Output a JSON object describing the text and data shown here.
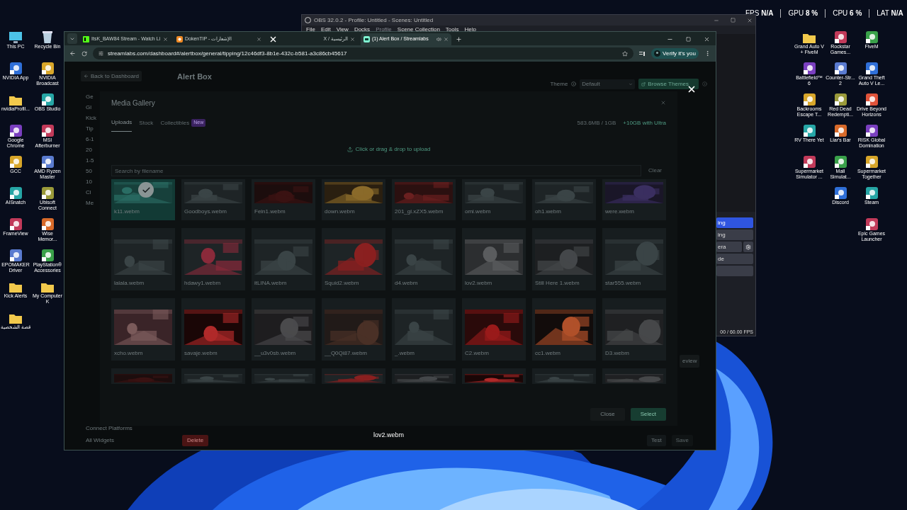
{
  "overlay_stats": [
    {
      "label": "FPS",
      "value": "N/A"
    },
    {
      "label": "GPU",
      "value": "8 %"
    },
    {
      "label": "CPU",
      "value": "6 %"
    },
    {
      "label": "LAT",
      "value": "N/A"
    }
  ],
  "desktop_left": [
    [
      {
        "label": "This PC",
        "kind": "pc"
      },
      {
        "label": "NVIDIA App",
        "kind": "app"
      },
      {
        "label": "nvidiaProfil...",
        "kind": "folder"
      },
      {
        "label": "Google Chrome",
        "kind": "app"
      },
      {
        "label": "GCC",
        "kind": "app"
      },
      {
        "label": "AISnatch",
        "kind": "app"
      },
      {
        "label": "FrameView",
        "kind": "app"
      },
      {
        "label": "EPOMAKER Driver",
        "kind": "app"
      },
      {
        "label": "Kick Alerts",
        "kind": "folder"
      },
      {
        "label": "قصة الشخصية",
        "kind": "folder"
      }
    ],
    [
      {
        "label": "Recycle Bin",
        "kind": "bin"
      },
      {
        "label": "NVIDIA Broadcast",
        "kind": "app"
      },
      {
        "label": "OBS Studio",
        "kind": "app"
      },
      {
        "label": "MSI Afterburner",
        "kind": "app"
      },
      {
        "label": "AMD Ryzen Master",
        "kind": "app"
      },
      {
        "label": "Ubisoft Connect",
        "kind": "app"
      },
      {
        "label": "Wise Memor...",
        "kind": "app"
      },
      {
        "label": "PlayStation® Accessories",
        "kind": "app"
      },
      {
        "label": "My Computer K",
        "kind": "folder"
      }
    ]
  ],
  "desktop_right": [
    [
      {
        "label": "Grand Auto V + FiveM",
        "kind": "folder"
      },
      {
        "label": "Battlefield™ 6",
        "kind": "app"
      },
      {
        "label": "Backrooms Escape T...",
        "kind": "app"
      },
      {
        "label": "RV There Yet",
        "kind": "app"
      },
      {
        "label": "Supermarket Simulator ...",
        "kind": "app"
      }
    ],
    [
      {
        "label": "Rockstar Games...",
        "kind": "app"
      },
      {
        "label": "Counter-Str... 2",
        "kind": "app"
      },
      {
        "label": "Red Dead Redempti...",
        "kind": "app"
      },
      {
        "label": "Liar's Bar",
        "kind": "app"
      },
      {
        "label": "Mall Simulat...",
        "kind": "app"
      },
      {
        "label": "Discord",
        "kind": "app"
      }
    ],
    [
      {
        "label": "FiveM",
        "kind": "app"
      },
      {
        "label": "Grand Theft Auto V Le...",
        "kind": "app"
      },
      {
        "label": "Drive Beyond Horizons",
        "kind": "app"
      },
      {
        "label": "RISK Global Domination",
        "kind": "app"
      },
      {
        "label": "Supermarket Together",
        "kind": "app"
      },
      {
        "label": "Steam",
        "kind": "app"
      },
      {
        "label": "Epic Games Launcher",
        "kind": "app"
      }
    ]
  ],
  "obs": {
    "title": "OBS 32.0.2 - Profile: Untitled - Scenes: Untitled",
    "menu": [
      {
        "label": "File",
        "disabled": false
      },
      {
        "label": "Edit",
        "disabled": false
      },
      {
        "label": "View",
        "disabled": false
      },
      {
        "label": "Docks",
        "disabled": false
      },
      {
        "label": "Profile",
        "disabled": true
      },
      {
        "label": "Scene Collection",
        "disabled": false
      },
      {
        "label": "Tools",
        "disabled": false
      },
      {
        "label": "Help",
        "disabled": false
      }
    ],
    "dock_items": [
      {
        "label": "ing",
        "selected": true,
        "settings": false
      },
      {
        "label": "ing",
        "selected": false,
        "settings": false
      },
      {
        "label": "era",
        "selected": false,
        "settings": true
      },
      {
        "label": "de",
        "selected": false,
        "settings": false
      }
    ],
    "fps": "00 / 60.00 FPS"
  },
  "browser": {
    "tabs": [
      {
        "title": "ItsK_BAW84 Stream - Watch Li",
        "kind": "kick",
        "selected": false,
        "audio": false
      },
      {
        "title": "DokenTIP - الإشعارات",
        "kind": "doken",
        "selected": false,
        "audio": false
      },
      {
        "title": "X / الرئيسية",
        "kind": "x",
        "selected": false,
        "audio": false
      },
      {
        "title": "(1) Alert Box / Streamlabs",
        "kind": "streamlabs",
        "selected": true,
        "audio": true
      }
    ],
    "url": "streamlabs.com/dashboard#/alertbox/general/tipping/12c46df3-8b1e-432c-b581-a3c86cb45617",
    "verify": "Verify it's you"
  },
  "page": {
    "back": "Back to Dashboard",
    "title": "Alert Box",
    "theme_label": "Theme",
    "theme_value": "Default",
    "browse": "Browse Themes",
    "sidebar": [
      "Ge",
      "Gl",
      "Kick",
      "Tip",
      "6-1",
      "20",
      "1-5",
      "50",
      "10",
      "Cl",
      "Me"
    ],
    "bottom_links": [
      "Connect Platforms",
      "All Widgets"
    ],
    "delete": "Delete",
    "preview": "eview",
    "test": "Test",
    "save": "Save"
  },
  "gallery": {
    "title": "Media Gallery",
    "tabs": [
      {
        "label": "Uploads",
        "selected": true
      },
      {
        "label": "Stock",
        "selected": false
      },
      {
        "label": "Collectibles",
        "selected": false,
        "badge": "New"
      }
    ],
    "usage": "583.6MB / 1GB",
    "upgrade": "+10GB with Ultra",
    "upload": "Click or drag & drop to upload",
    "search_placeholder": "Search by filename",
    "clear": "Clear",
    "items": [
      {
        "name": "k11.webm",
        "selected": true
      },
      {
        "name": "Goodboys.webm",
        "selected": false
      },
      {
        "name": "Fein1.webm",
        "selected": false
      },
      {
        "name": "down.webm",
        "selected": false
      },
      {
        "name": "201_gl.xZX5.webm",
        "selected": false
      },
      {
        "name": "omi.webm",
        "selected": false
      },
      {
        "name": "oh1.webm",
        "selected": false
      },
      {
        "name": "were.webm",
        "selected": false
      },
      {
        "name": "lalala.webm",
        "selected": false
      },
      {
        "name": "hdawy1.webm",
        "selected": false
      },
      {
        "name": "itLINA.webm",
        "selected": false
      },
      {
        "name": "Squid2.webm",
        "selected": false
      },
      {
        "name": "d4.webm",
        "selected": false
      },
      {
        "name": "lov2.webm",
        "selected": false
      },
      {
        "name": "Still Here 1.webm",
        "selected": false
      },
      {
        "name": "star555.webm",
        "selected": false
      },
      {
        "name": "xcho.webm",
        "selected": false
      },
      {
        "name": "savaje.webm",
        "selected": false
      },
      {
        "name": "__u3v0sb.webm",
        "selected": false
      },
      {
        "name": "__Q0Qi87.webm",
        "selected": false
      },
      {
        "name": "_.webm",
        "selected": false
      },
      {
        "name": "C2.webm",
        "selected": false
      },
      {
        "name": "cc1.webm",
        "selected": false
      },
      {
        "name": "D3.webm",
        "selected": false
      }
    ],
    "close": "Close",
    "select": "Select"
  },
  "lightbox": {
    "caption": "lov2.webm"
  }
}
